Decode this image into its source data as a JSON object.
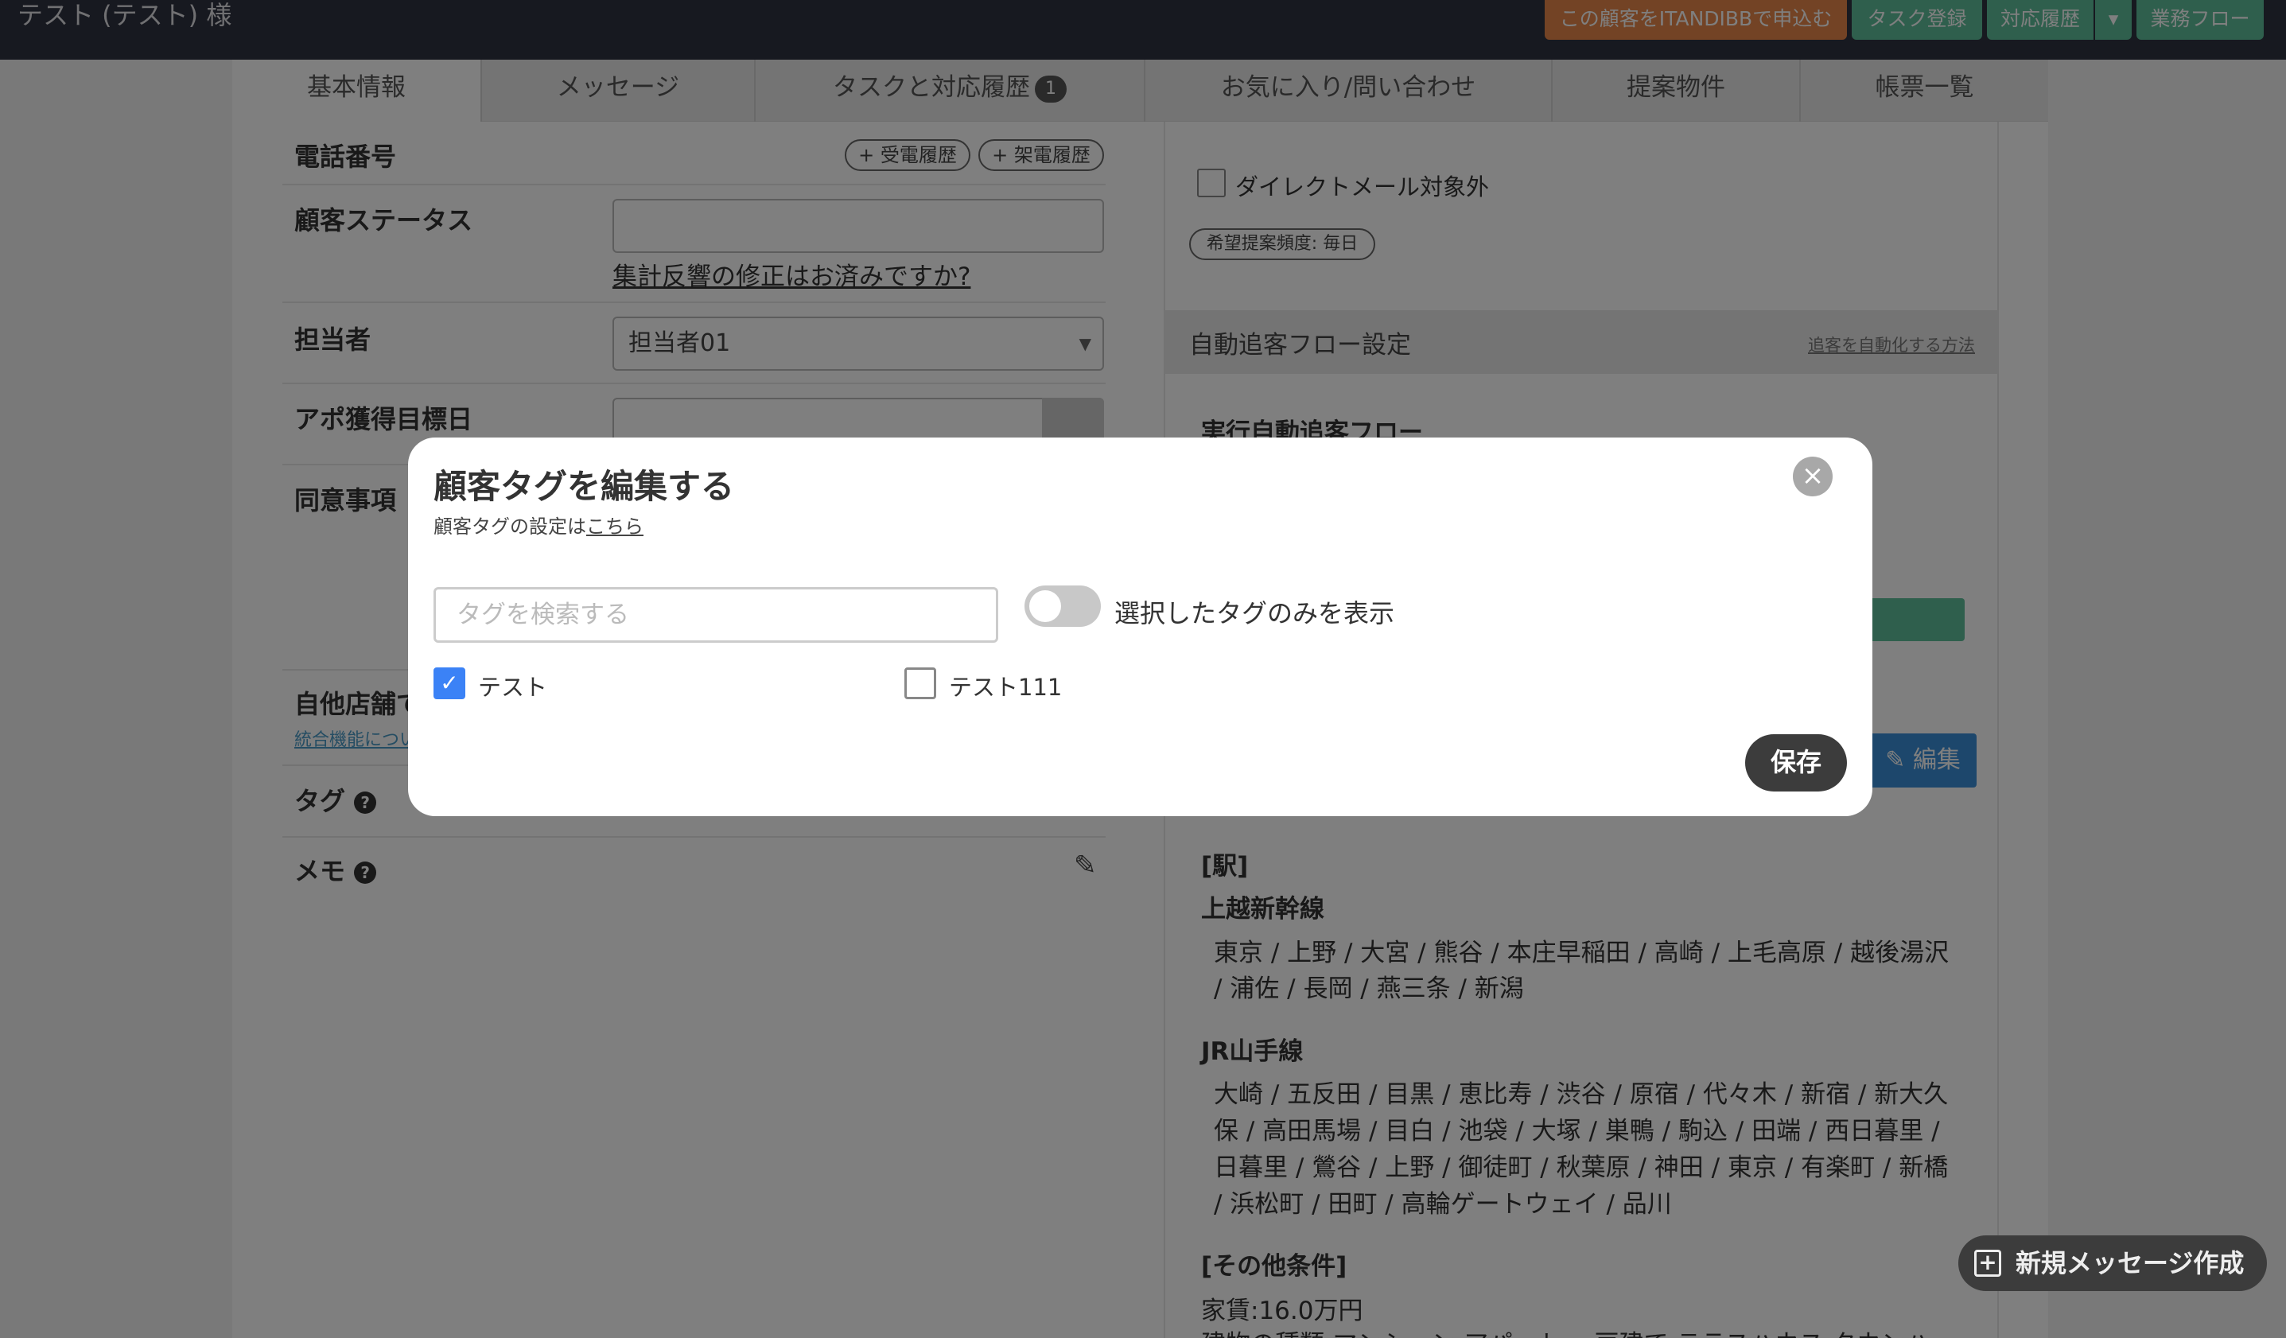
{
  "header": {
    "title": "テスト (テスト) 様",
    "buttons": {
      "itandi": "この顧客をITANDIBBで申込む",
      "task": "タスク登録",
      "history": "対応履歴",
      "dropdown": "▾",
      "flow": "業務フロー"
    }
  },
  "tabs": {
    "basic": "基本情報",
    "message": "メッセージ",
    "task": "タスクと対応履歴",
    "task_badge": "1",
    "favorites": "お気に入り/問い合わせ",
    "proposals": "提案物件",
    "reports": "帳票一覧"
  },
  "left": {
    "phone_label": "電話番号",
    "incoming_btn": "+ 受電履歴",
    "outgoing_btn": "+ 架電履歴",
    "status_label": "顧客ステータス",
    "status_link": "集計反響の修正はお済みですか?",
    "assignee_label": "担当者",
    "assignee_value": "担当者01",
    "appt_label": "アポ獲得目標日",
    "consent_label": "同意事項",
    "other_store_label": "自他店舗で",
    "integration_link": "統合機能につい",
    "tag_label": "タグ",
    "memo_label": "メモ"
  },
  "right": {
    "dm_label": "ダイレクトメール対象外",
    "frequency": "希望提案頻度: 毎日",
    "auto_flow_title": "自動追客フロー設定",
    "auto_flow_link": "追客を自動化する方法",
    "exec_flow": "実行自動追客フロー",
    "edit_btn": "編集",
    "station_header": "[駅]",
    "line1": "上越新幹線",
    "line1_stations_a": "東京 / 上野 / 大宮 / 熊谷 / 本庄早稲田 / 高崎 / 上毛高原 / 越後湯沢",
    "line1_stations_b": "/ 浦佐 / 長岡 / 燕三条 / 新潟",
    "line2": "JR山手線",
    "line2_stations_a": "大崎 / 五反田 / 目黒 / 恵比寿 / 渋谷 / 原宿 / 代々木 / 新宿 / 新大久",
    "line2_stations_b": "保 / 高田馬場 / 目白 / 池袋 / 大塚 / 巣鴨 / 駒込 / 田端 / 西日暮里 /",
    "line2_stations_c": "日暮里 / 鶯谷 / 上野 / 御徒町 / 秋葉原 / 神田 / 東京 / 有楽町 / 新橋",
    "line2_stations_d": "/ 浜松町 / 田町 / 高輪ゲートウェイ / 品川",
    "other_header": "[その他条件]",
    "rent": "家賃:16.0万円",
    "building_types": "建物の種類:マンション,アパート,一戸建て,テラスハウス,タウンハ"
  },
  "modal": {
    "title": "顧客タグを編集する",
    "subtitle_prefix": "顧客タグの設定は",
    "subtitle_link": "こちら",
    "search_placeholder": "タグを検索する",
    "toggle_label": "選択したタグのみを表示",
    "toggle_on": false,
    "tags": [
      {
        "label": "テスト",
        "checked": true
      },
      {
        "label": "テスト111",
        "checked": false
      }
    ],
    "save": "保存",
    "close": "×"
  },
  "fab": {
    "label": "新規メッセージ作成"
  },
  "colors": {
    "topbar": "#2f3240",
    "orange": "#e6874a",
    "green": "#5fbf9a",
    "check_blue": "#3b82f6",
    "dark_button": "#3c3c3c"
  }
}
